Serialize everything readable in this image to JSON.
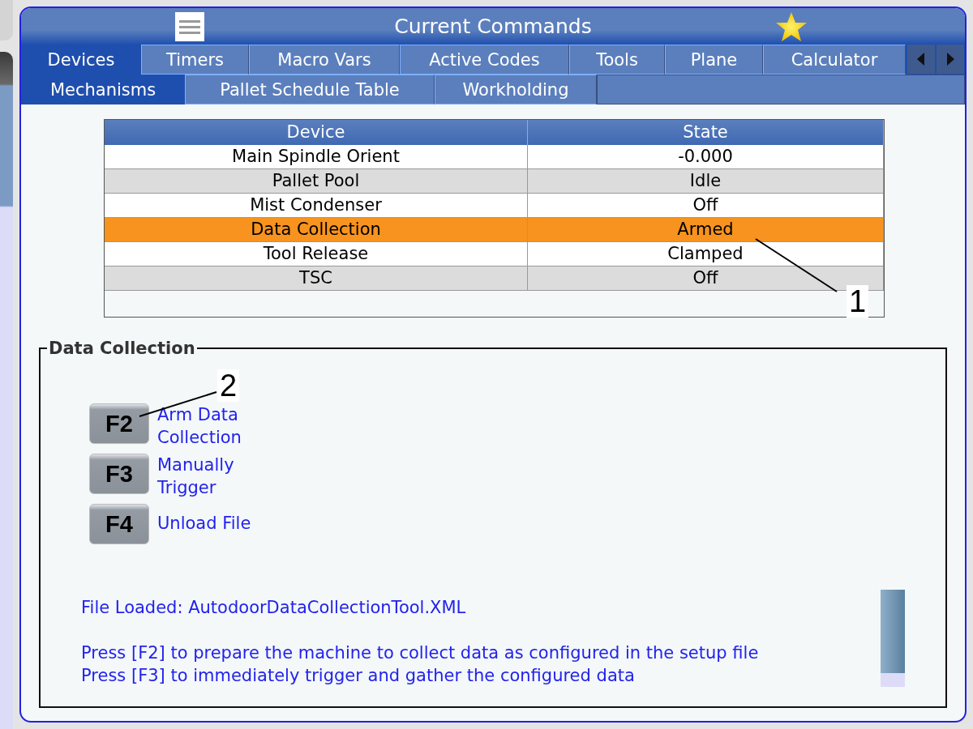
{
  "window": {
    "title": "Current Commands"
  },
  "tab_rows": [
    {
      "tabs": [
        {
          "label": "Devices",
          "selected": true
        },
        {
          "label": "Timers",
          "selected": false
        },
        {
          "label": "Macro Vars",
          "selected": false
        },
        {
          "label": "Active Codes",
          "selected": false
        },
        {
          "label": "Tools",
          "selected": false
        },
        {
          "label": "Plane",
          "selected": false
        },
        {
          "label": "Calculator",
          "selected": false
        }
      ]
    },
    {
      "tabs": [
        {
          "label": "Mechanisms",
          "selected": true
        },
        {
          "label": "Pallet Schedule Table",
          "selected": false
        },
        {
          "label": "Workholding",
          "selected": false
        }
      ]
    }
  ],
  "table": {
    "columns": [
      "Device",
      "State"
    ],
    "rows": [
      {
        "device": "Main Spindle Orient",
        "state": "-0.000",
        "selected": false
      },
      {
        "device": "Pallet Pool",
        "state": "Idle",
        "selected": false
      },
      {
        "device": "Mist Condenser",
        "state": "Off",
        "selected": false
      },
      {
        "device": "Data Collection",
        "state": "Armed",
        "selected": true
      },
      {
        "device": "Tool Release",
        "state": "Clamped",
        "selected": false
      },
      {
        "device": "TSC",
        "state": "Off",
        "selected": false
      }
    ]
  },
  "section": {
    "title": "Data Collection",
    "keys": [
      {
        "key": "F2",
        "label": "Arm Data Collection"
      },
      {
        "key": "F3",
        "label": "Manually Trigger"
      },
      {
        "key": "F4",
        "label": "Unload File"
      }
    ],
    "message_blocks": [
      {
        "lines": [
          "File Loaded: AutodoorDataCollectionTool.XML"
        ]
      },
      {
        "lines": [
          "Press [F2] to prepare the machine to collect data as configured in the setup file",
          "Press [F3] to immediately trigger and gather the configured data"
        ]
      }
    ]
  },
  "callouts": [
    "1",
    "2"
  ]
}
